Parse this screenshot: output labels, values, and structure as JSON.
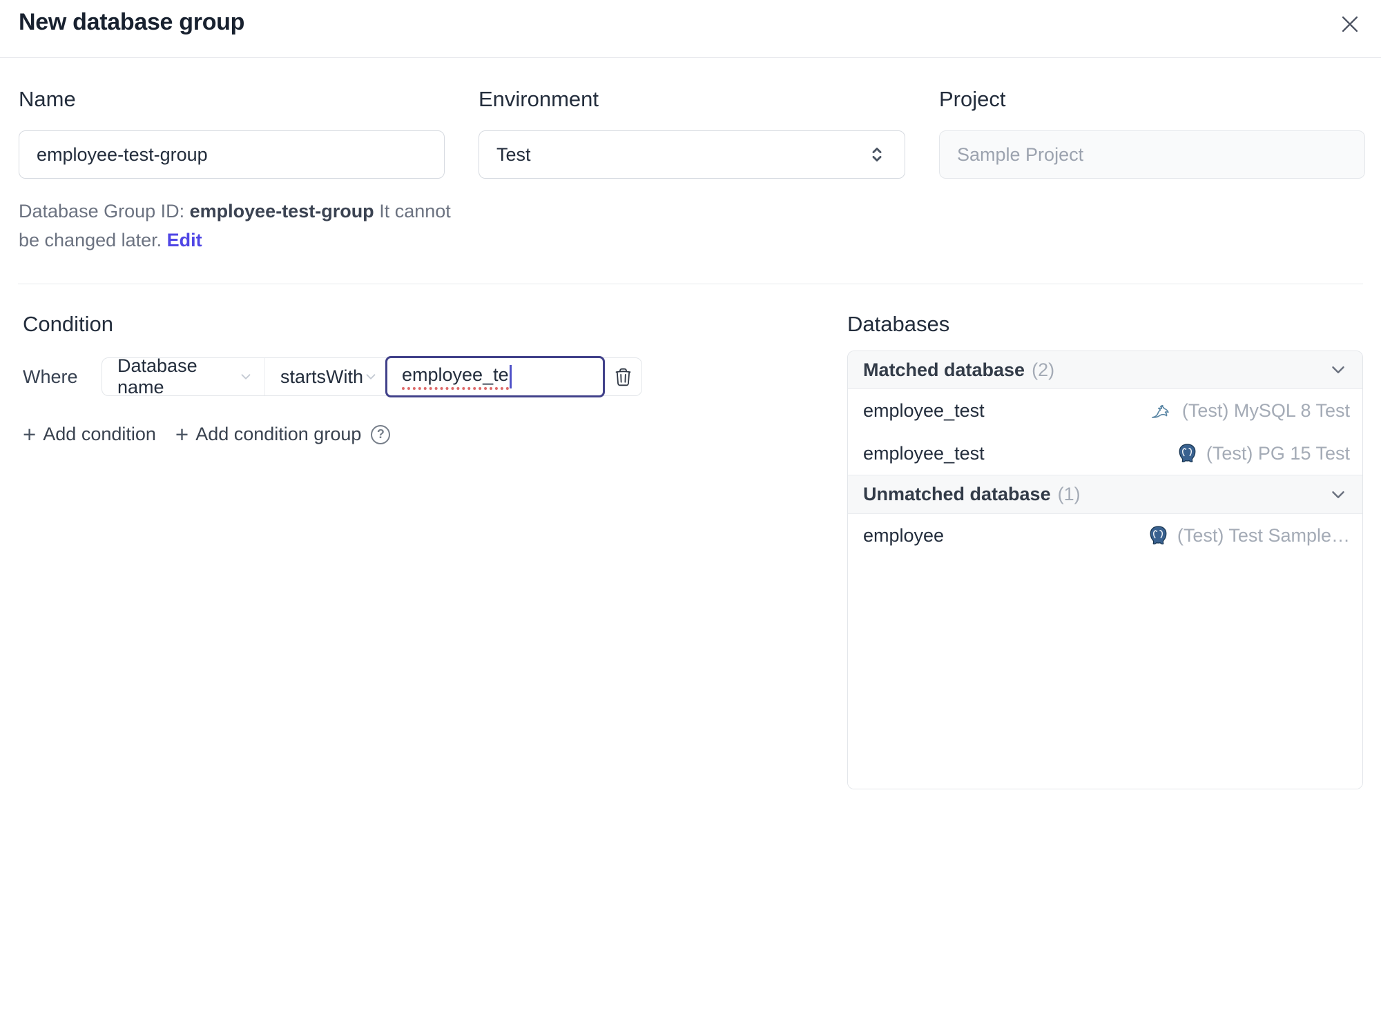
{
  "dialog": {
    "title": "New database group"
  },
  "form": {
    "name_label": "Name",
    "name_value": "employee-test-group",
    "environment_label": "Environment",
    "environment_value": "Test",
    "project_label": "Project",
    "project_value": "Sample Project",
    "id_note_prefix": "Database Group ID: ",
    "id_note_id": "employee-test-group",
    "id_note_suffix": " It cannot be changed later. ",
    "edit_link": "Edit"
  },
  "condition": {
    "heading": "Condition",
    "where_label": "Where",
    "field_selected": "Database name",
    "operator_selected": "startsWith",
    "value": "employee_te",
    "plus_glyph": "+",
    "add_condition": "Add condition",
    "add_condition_group": "Add condition group",
    "help_glyph": "?"
  },
  "databases": {
    "heading": "Databases",
    "matched_header": {
      "title": "Matched database",
      "count": "(2)"
    },
    "matched_rows": [
      {
        "name": "employee_test",
        "engine": "mysql",
        "instance": "(Test) MySQL 8 Test"
      },
      {
        "name": "employee_test",
        "engine": "postgresql",
        "instance": "(Test) PG 15 Test"
      }
    ],
    "unmatched_header": {
      "title": "Unmatched database",
      "count": "(1)"
    },
    "unmatched_rows": [
      {
        "name": "employee",
        "engine": "postgresql",
        "instance": "(Test) Test Sample…"
      }
    ]
  },
  "colors": {
    "accent": "#4f46e5",
    "focus_border": "#41418a",
    "spellcheck_red": "#dd6a6a",
    "mysql_icon": "#5b87a5",
    "postgresql_icon": "#336791",
    "muted_text": "#a4abb6",
    "panel_header_bg": "#f7f8f9",
    "border": "#e3e6ea"
  }
}
